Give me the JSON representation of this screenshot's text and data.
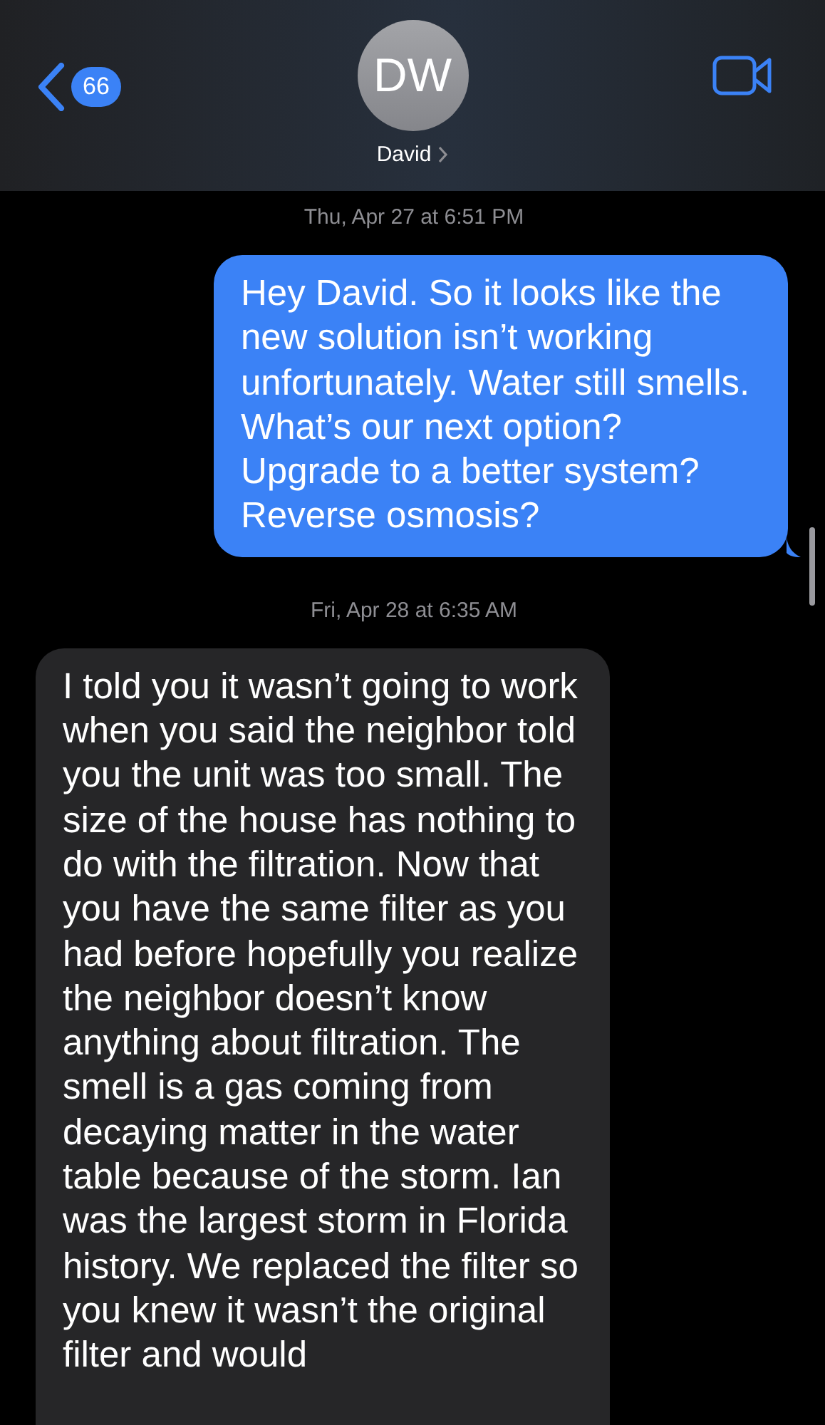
{
  "header": {
    "back_badge": "66",
    "avatar_initials": "DW",
    "contact_name": "David"
  },
  "messages": [
    {
      "kind": "timestamp",
      "text": "Thu, Apr 27 at 6:51 PM"
    },
    {
      "kind": "outgoing",
      "text": "Hey David. So it looks like the new solution isn’t working unfortunately. Water still smells. What’s our next option? Upgrade to a better system? Reverse osmosis?"
    },
    {
      "kind": "timestamp",
      "text": "Fri, Apr 28 at 6:35 AM"
    },
    {
      "kind": "incoming",
      "text": "I told you it wasn’t going to work when you said the neighbor told you the unit was too small. The size of the house has nothing to do with the filtration. Now that you have the same filter as you had before hopefully you realize the neighbor doesn’t know anything about filtration. The smell is a gas coming from decaying matter in the water table because of the storm. Ian was the largest storm in Florida history. We replaced the filter so you knew it wasn’t the original filter and would"
    }
  ]
}
